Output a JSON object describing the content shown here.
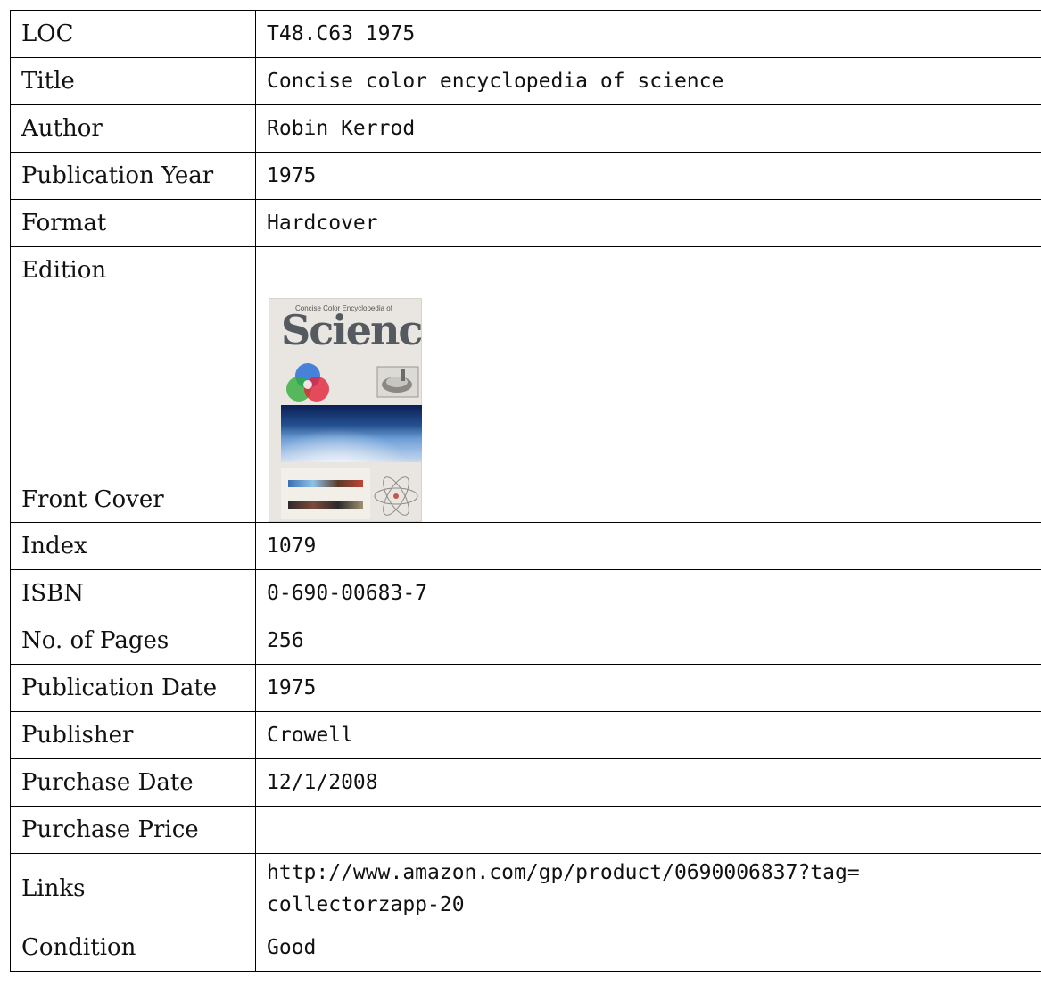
{
  "rows": [
    {
      "label": "LOC",
      "value": "T48.C63 1975"
    },
    {
      "label": "Title",
      "value": "Concise color encyclopedia of science"
    },
    {
      "label": "Author",
      "value": "Robin Kerrod"
    },
    {
      "label": "Publication Year",
      "value": "1975"
    },
    {
      "label": "Format",
      "value": "Hardcover"
    },
    {
      "label": "Edition",
      "value": ""
    },
    {
      "label": "Front Cover"
    },
    {
      "label": "Index",
      "value": "1079"
    },
    {
      "label": "ISBN",
      "value": "0-690-00683-7"
    },
    {
      "label": "No. of Pages",
      "value": "256"
    },
    {
      "label": "Publication Date",
      "value": "1975"
    },
    {
      "label": "Publisher",
      "value": "Crowell"
    },
    {
      "label": "Purchase Date",
      "value": "12/1/2008"
    },
    {
      "label": "Purchase Price",
      "value": ""
    },
    {
      "label": "Links",
      "value_line1": "http://www.amazon.com/gp/product/0690006837?tag=",
      "value_line2": "collectorzapp-20"
    },
    {
      "label": "Condition",
      "value": "Good"
    }
  ],
  "cover": {
    "subtitle": "Concise Color Encyclopedia of",
    "title": "Science"
  }
}
